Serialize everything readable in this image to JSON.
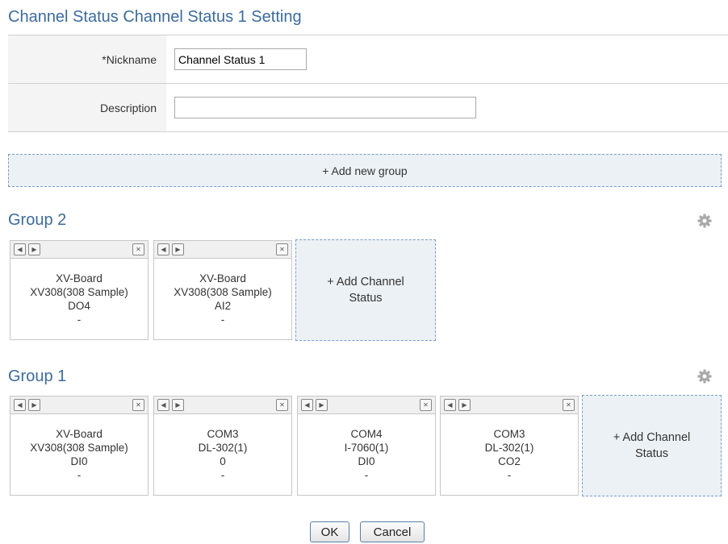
{
  "page": {
    "title": "Channel Status Channel Status 1 Setting"
  },
  "form": {
    "nickname_label": "*Nickname",
    "nickname_value": "Channel Status 1",
    "description_label": "Description",
    "description_value": ""
  },
  "add_group_label": "+ Add new group",
  "add_channel_label_line1": "+ Add Channel",
  "add_channel_label_line2": "Status",
  "groups": [
    {
      "title": "Group 2",
      "cards": [
        {
          "lines": [
            "XV-Board",
            "XV308(308 Sample)",
            "DO4",
            "-"
          ]
        },
        {
          "lines": [
            "XV-Board",
            "XV308(308 Sample)",
            "AI2",
            "-"
          ]
        }
      ]
    },
    {
      "title": "Group 1",
      "cards": [
        {
          "lines": [
            "XV-Board",
            "XV308(308 Sample)",
            "DI0",
            "-"
          ]
        },
        {
          "lines": [
            "COM3",
            "DL-302(1)",
            "0",
            "-"
          ]
        },
        {
          "lines": [
            "COM4",
            "I-7060(1)",
            "DI0",
            "-"
          ]
        },
        {
          "lines": [
            "COM3",
            "DL-302(1)",
            "CO2",
            "-"
          ]
        }
      ]
    }
  ],
  "buttons": {
    "ok": "OK",
    "cancel": "Cancel"
  },
  "icons": {
    "move_left": "move-left-icon",
    "move_right": "move-right-icon",
    "remove": "close-icon",
    "settings": "gear-icon"
  },
  "colors": {
    "title": "#3c6b9c",
    "dashed_border": "#7a9ccc",
    "add_bg": "#ecf1f5"
  }
}
